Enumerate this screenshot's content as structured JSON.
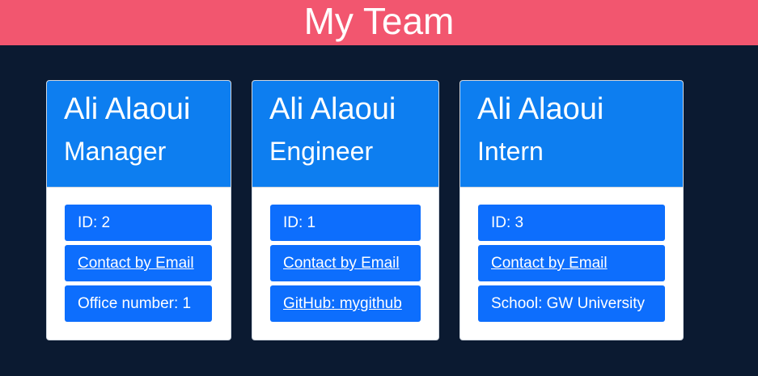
{
  "header": {
    "title": "My Team"
  },
  "cards": [
    {
      "name": "Ali Alaoui",
      "role": "Manager",
      "id_text": "ID: 2",
      "email_link": "Contact by Email",
      "extra": "Office number: 1"
    },
    {
      "name": "Ali Alaoui",
      "role": "Engineer",
      "id_text": "ID: 1",
      "email_link": "Contact by Email",
      "extra": "GitHub: mygithub"
    },
    {
      "name": "Ali Alaoui",
      "role": "Intern",
      "id_text": "ID: 3",
      "email_link": "Contact by Email",
      "extra": "School: GW University"
    }
  ],
  "colors": {
    "header_bg": "#f2566f",
    "page_bg": "#0b1a31",
    "card_header_bg": "#0d7ef0",
    "item_bg": "#0d6efd"
  }
}
